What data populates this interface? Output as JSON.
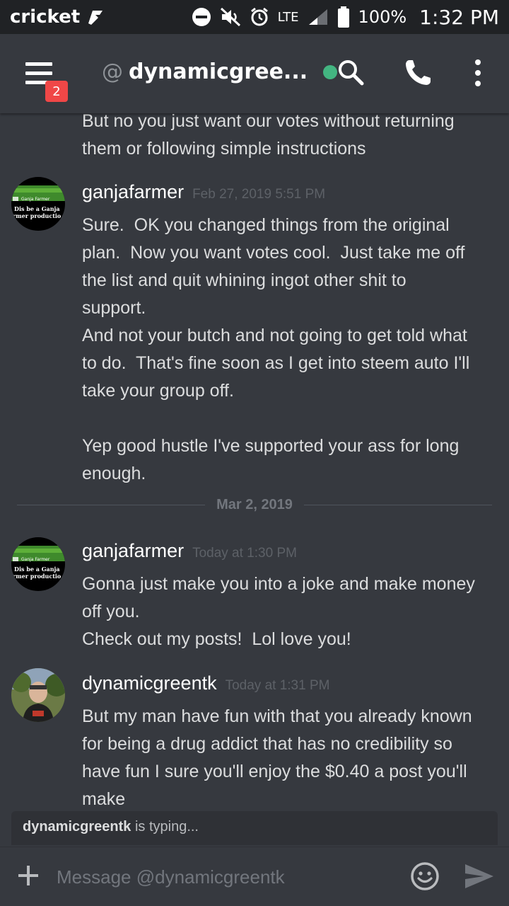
{
  "status_bar": {
    "carrier": "cricket",
    "network": "LTE",
    "battery": "100%",
    "time": "1:32 PM"
  },
  "header": {
    "unread_badge": "2",
    "at_symbol": "@",
    "channel_name": "dynamicgree...",
    "online_color": "#43b581"
  },
  "messages": {
    "continuation_text": "But no you just want our votes without returning\nthem or following simple instructions",
    "groups": [
      {
        "author": "ganjafarmer",
        "timestamp": "Feb 27, 2019 5:51 PM",
        "avatar_text": "Dis be a Ganja\nrmer productio",
        "avatar_banner": "Ganja Farmer",
        "text": "Sure.  OK you changed things from the original\nplan.  Now you want votes cool.  Just take me off\nthe list and quit whining ingot other shit to\nsupport.\nAnd not your butch and not going to get told what\nto do.  That's fine soon as I get into steem auto I'll\ntake your group off.\n\nYep good hustle I've supported your ass for long\nenough."
      },
      {
        "author": "ganjafarmer",
        "timestamp": "Today at 1:30 PM",
        "avatar_text": "Dis be a Ganja\nrmer productio",
        "avatar_banner": "Ganja Farmer",
        "text": "Gonna just make you into a joke and make money\noff you.\nCheck out my posts!  Lol love you!"
      },
      {
        "author": "dynamicgreentk",
        "timestamp": "Today at 1:31 PM",
        "text": "But my man have fun with that you already known\nfor being a drug addict that has no credibility so\nhave fun I sure you'll enjoy the $0.40 a post you'll\nmake"
      }
    ],
    "date_divider": "Mar 2, 2019"
  },
  "typing": {
    "user": "dynamicgreentk",
    "suffix": " is typing..."
  },
  "composer": {
    "placeholder": "Message @dynamicgreentk"
  },
  "colors": {
    "background": "#36393f",
    "status_bar": "#202225",
    "badge": "#f04747"
  }
}
